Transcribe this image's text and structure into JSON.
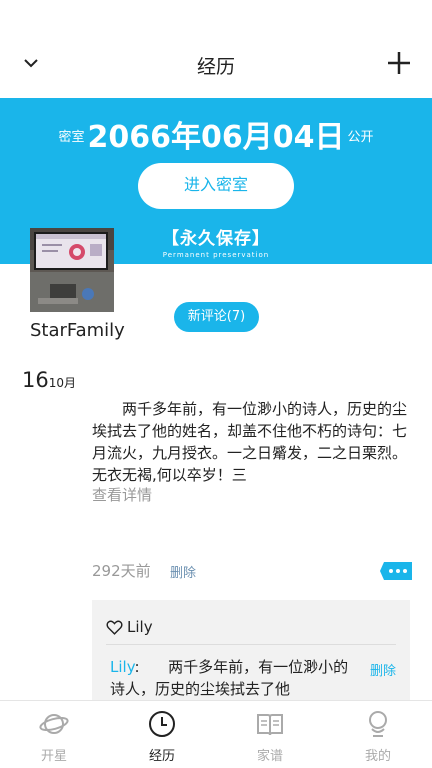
{
  "header": {
    "title": "经历"
  },
  "banner": {
    "prefix": "密室",
    "date": "2066年06月04日",
    "suffix": "公开",
    "enter_label": "进入密室",
    "permanent_cn": "【永久保存】",
    "permanent_en": "Permanent preservation"
  },
  "profile": {
    "family_name": "StarFamily",
    "new_comments": "新评论(7)"
  },
  "entry": {
    "day": "16",
    "month": "10月",
    "text": "两千多年前，有一位渺小的诗人，历史的尘埃拭去了他的姓名，却盖不住他不朽的诗句：七月流火，九月授衣。一之日觱发，二之日栗烈。无衣无褐,何以卒岁！三",
    "more": "查看详情",
    "time_ago": "292天前",
    "delete": "删除"
  },
  "comment_box": {
    "like_user": "Lily",
    "comment_user": "Lily",
    "comment_sep": ":",
    "comment_text": "两千多年前，有一位渺小的诗人，历史的尘埃拭去了他",
    "delete": "删除"
  },
  "tabs": [
    {
      "label": "开星",
      "icon": "planet-icon",
      "active": false
    },
    {
      "label": "经历",
      "icon": "clock-icon",
      "active": true
    },
    {
      "label": "家谱",
      "icon": "book-icon",
      "active": false
    },
    {
      "label": "我的",
      "icon": "person-icon",
      "active": false
    }
  ],
  "colors": {
    "accent": "#1ab5ea",
    "muted": "#999999"
  }
}
